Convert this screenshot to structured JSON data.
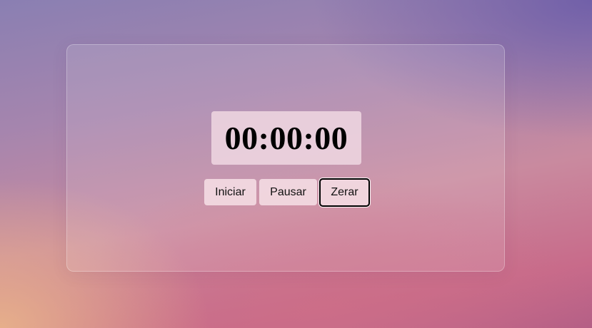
{
  "stopwatch": {
    "time": "00:00:00",
    "buttons": {
      "start": "Iniciar",
      "pause": "Pausar",
      "reset": "Zerar"
    },
    "focused_button": "reset"
  }
}
